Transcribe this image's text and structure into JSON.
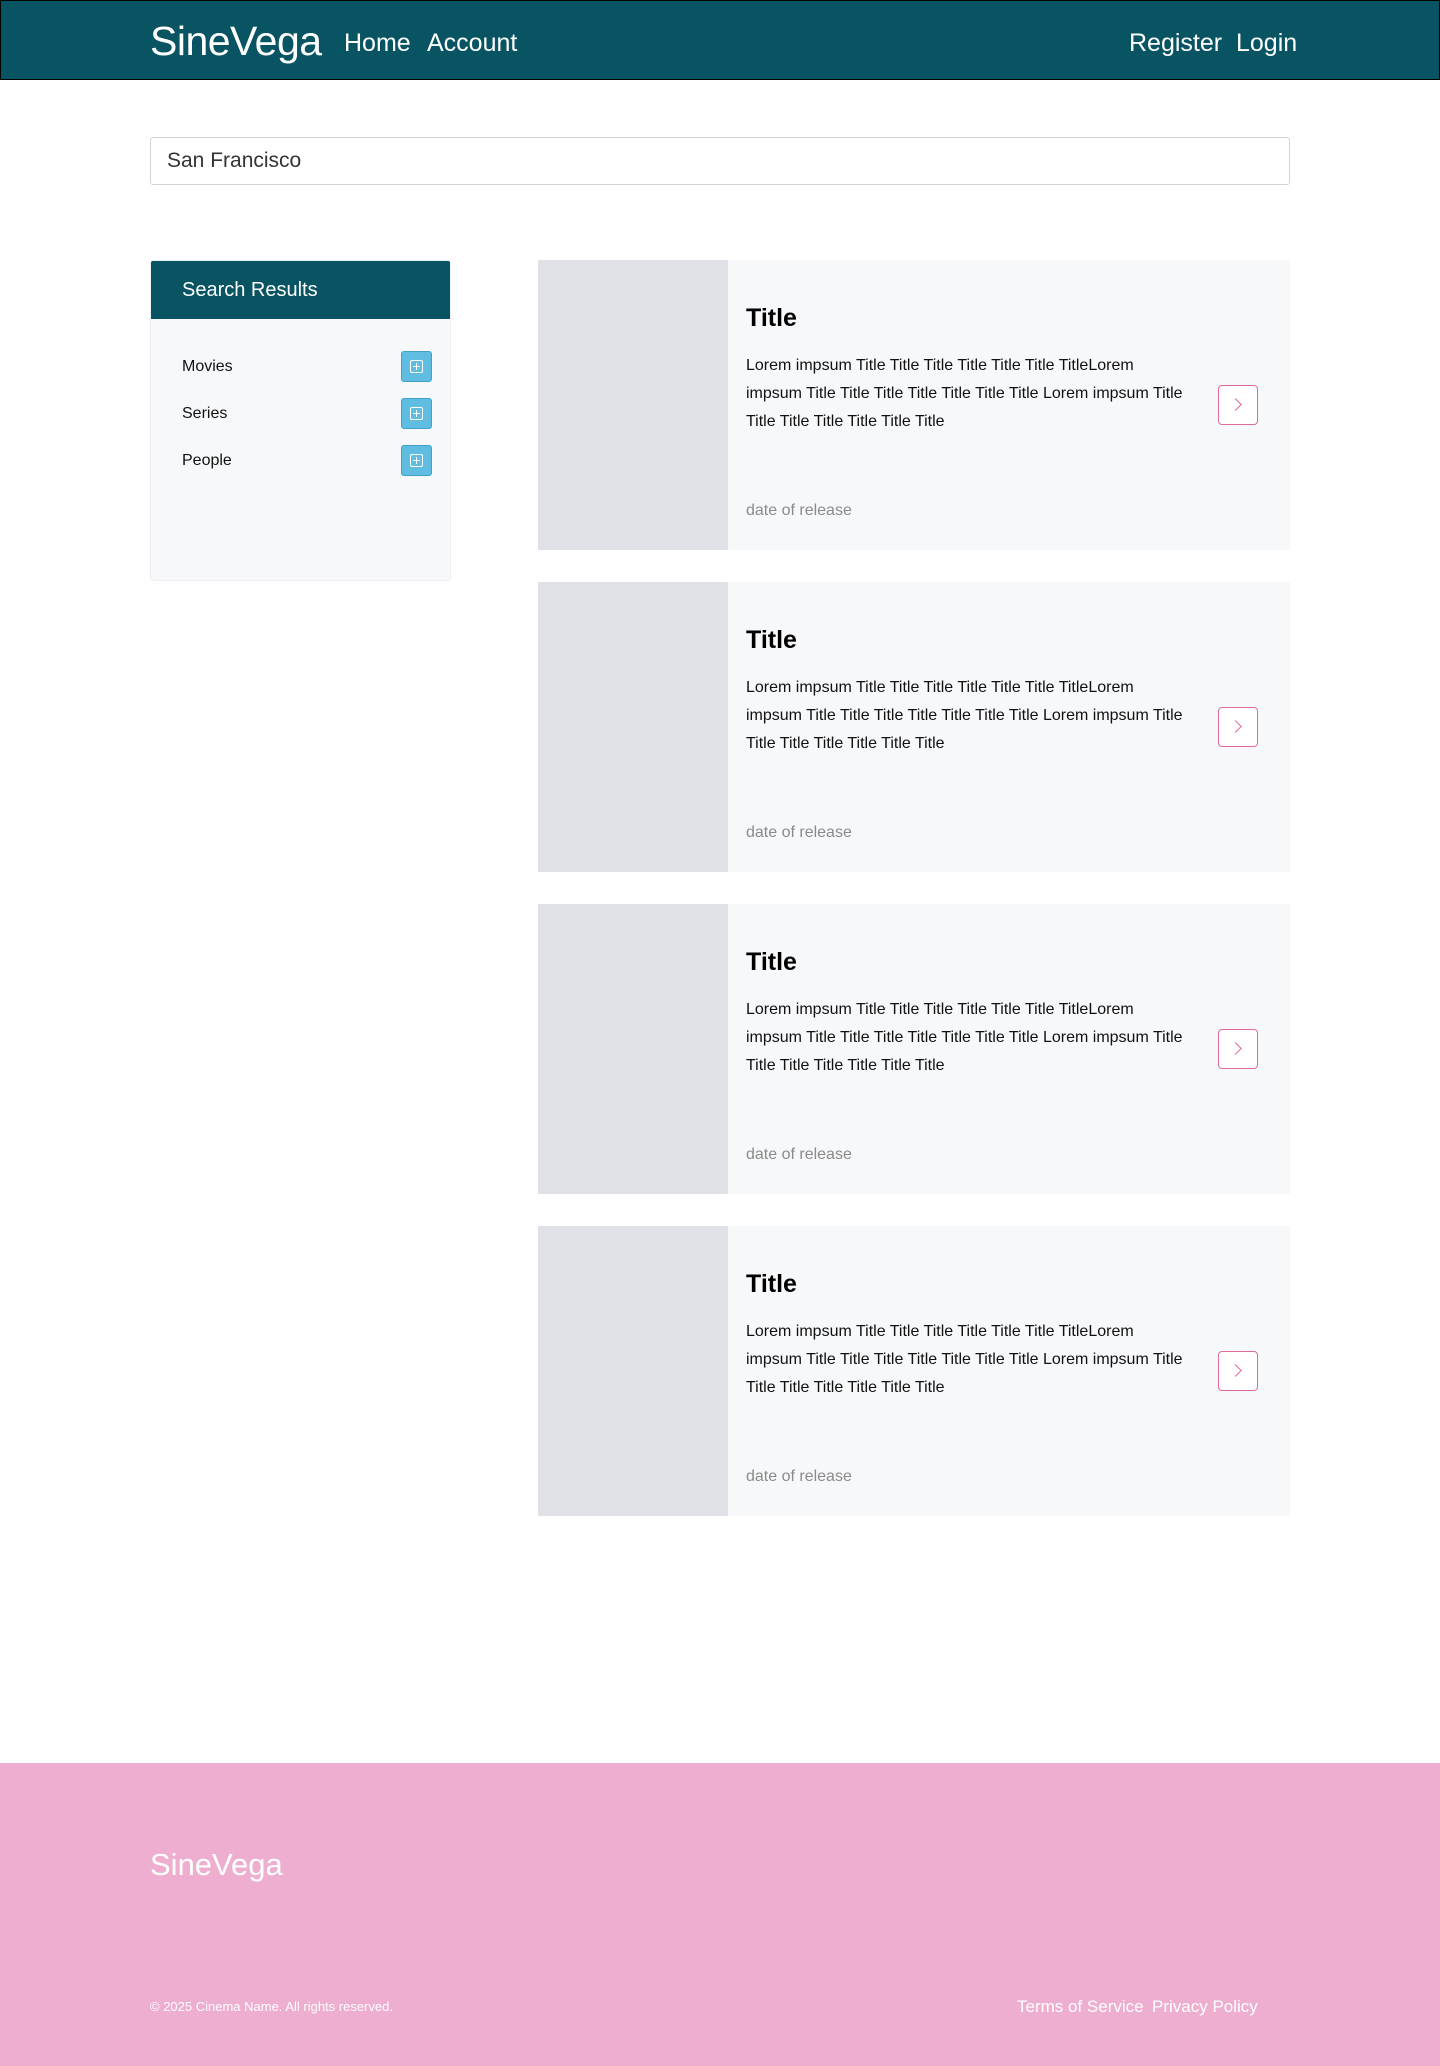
{
  "header": {
    "brand": "SineVega",
    "nav": {
      "home": "Home",
      "account": "Account"
    },
    "auth": {
      "register": "Register",
      "login": "Login"
    }
  },
  "search": {
    "value": "San Francisco"
  },
  "sidebar": {
    "title": "Search Results",
    "filters": [
      {
        "label": "Movies",
        "icon": "plus-square-icon"
      },
      {
        "label": "Series",
        "icon": "plus-square-icon"
      },
      {
        "label": "People",
        "icon": "plus-square-icon"
      }
    ]
  },
  "results": [
    {
      "title": "Title",
      "description": "Lorem impsum Title Title Title Title Title Title TitleLorem impsum Title Title Title Title Title Title Title Lorem impsum Title Title Title Title Title Title Title",
      "date": "date of release",
      "action_icon": "chevron-right-icon"
    },
    {
      "title": "Title",
      "description": "Lorem impsum Title Title Title Title Title Title TitleLorem impsum Title Title Title Title Title Title Title Lorem impsum Title Title Title Title Title Title Title",
      "date": "date of release",
      "action_icon": "chevron-right-icon"
    },
    {
      "title": "Title",
      "description": "Lorem impsum Title Title Title Title Title Title TitleLorem impsum Title Title Title Title Title Title Title Lorem impsum Title Title Title Title Title Title Title",
      "date": "date of release",
      "action_icon": "chevron-right-icon"
    },
    {
      "title": "Title",
      "description": "Lorem impsum Title Title Title Title Title Title TitleLorem impsum Title Title Title Title Title Title Title Lorem impsum Title Title Title Title Title Title Title",
      "date": "date of release",
      "action_icon": "chevron-right-icon"
    }
  ],
  "footer": {
    "brand": "SineVega",
    "copyright": "© 2025 Cinema Name. All rights reserved.",
    "links": {
      "terms": "Terms of Service",
      "privacy": "Privacy Policy"
    }
  },
  "colors": {
    "primary": "#085463",
    "accent": "#5ebde0",
    "pink": "#edaecf",
    "card_bg": "#f7f8fa",
    "image_placeholder": "#dfe1e6",
    "button_border": "#e06a9a"
  }
}
